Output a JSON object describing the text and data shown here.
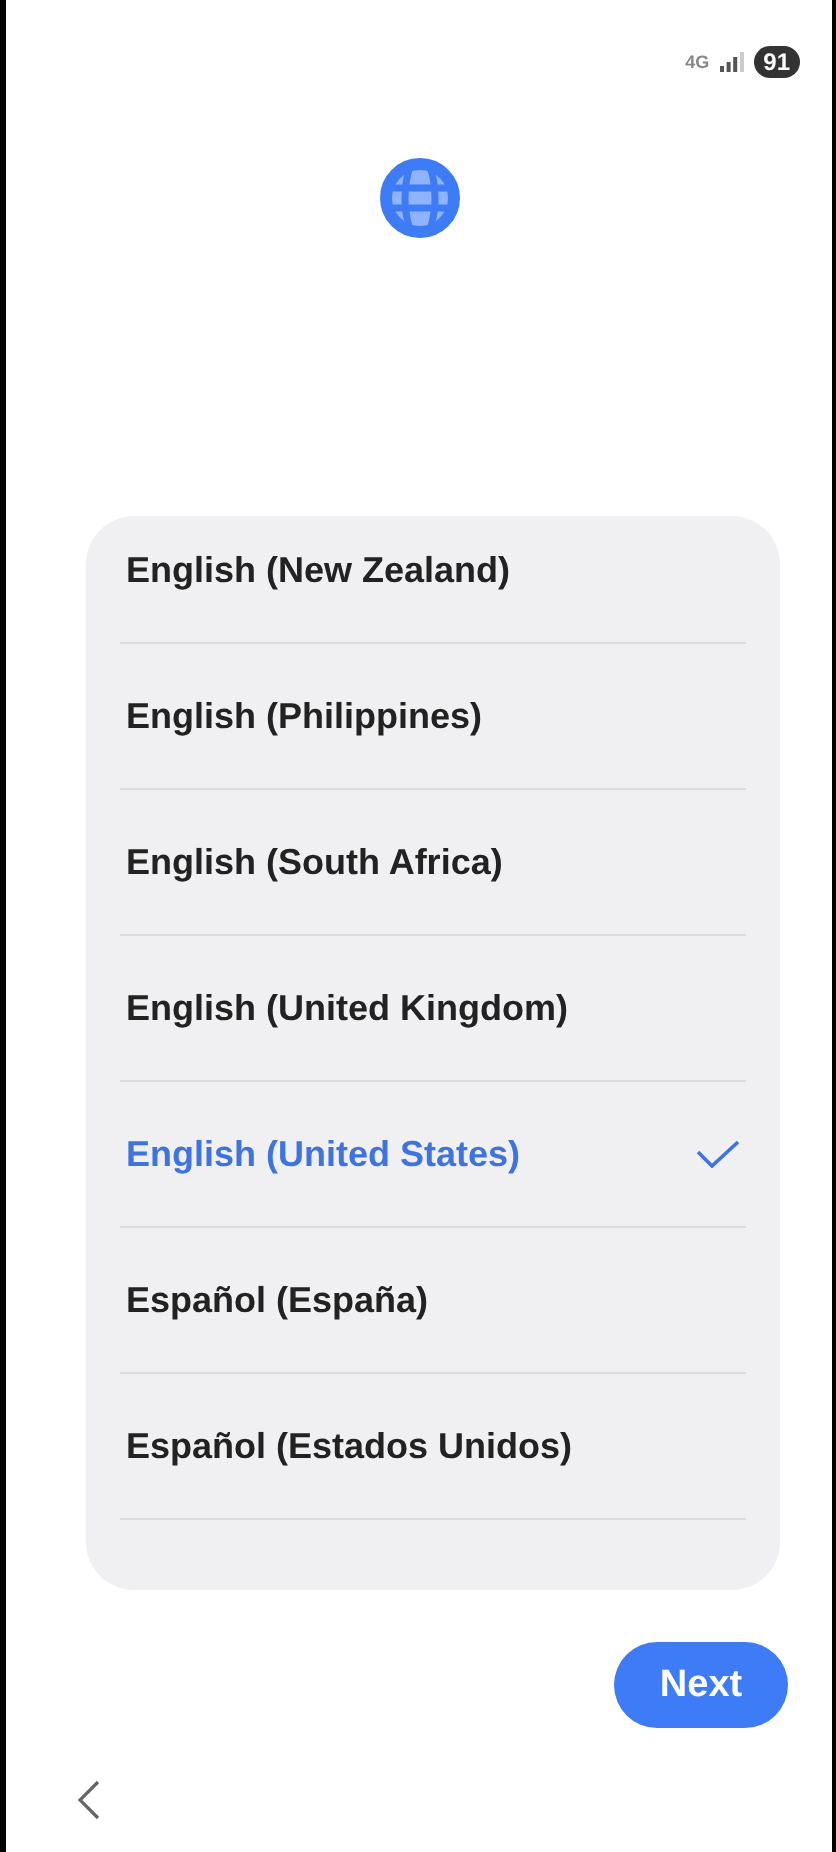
{
  "status_bar": {
    "network": "4G",
    "battery": "91"
  },
  "languages": [
    {
      "label": "English (New Zealand)",
      "selected": false
    },
    {
      "label": "English (Philippines)",
      "selected": false
    },
    {
      "label": "English (South Africa)",
      "selected": false
    },
    {
      "label": "English (United Kingdom)",
      "selected": false
    },
    {
      "label": "English (United States)",
      "selected": true
    },
    {
      "label": "Español (España)",
      "selected": false
    },
    {
      "label": "Español (Estados Unidos)",
      "selected": false
    }
  ],
  "next_button": "Next"
}
